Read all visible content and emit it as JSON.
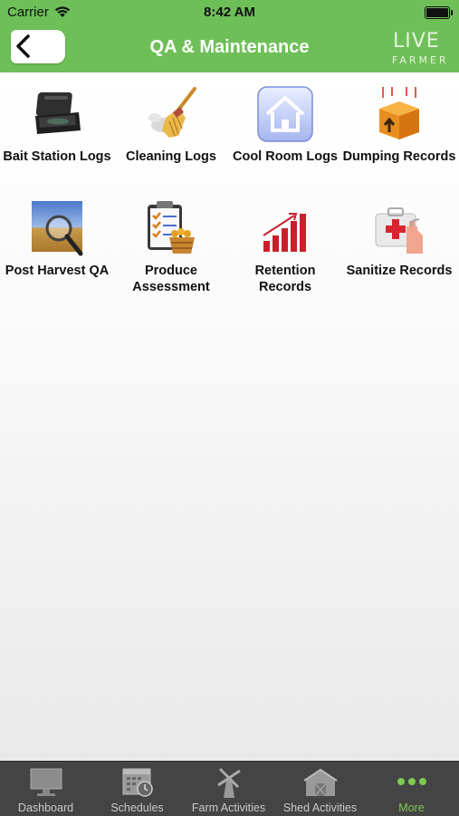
{
  "status_bar": {
    "carrier": "Carrier",
    "time": "8:42 AM"
  },
  "nav": {
    "title": "QA & Maintenance",
    "logo_line1": "LIVE",
    "logo_line2": "FARMER"
  },
  "grid": [
    {
      "label": "Bait Station Logs",
      "icon": "bait-station-icon"
    },
    {
      "label": "Cleaning Logs",
      "icon": "broom-icon"
    },
    {
      "label": "Cool Room Logs",
      "icon": "house-icon"
    },
    {
      "label": "Dumping Records",
      "icon": "box-upload-icon"
    },
    {
      "label": "Post Harvest QA",
      "icon": "magnifier-wheat-icon"
    },
    {
      "label": "Produce Assessment",
      "icon": "checklist-basket-icon"
    },
    {
      "label": "Retention Records",
      "icon": "bar-chart-icon"
    },
    {
      "label": "Sanitize Records",
      "icon": "sanitizer-kit-icon"
    }
  ],
  "tabs": [
    {
      "label": "Dashboard",
      "icon": "monitor-icon"
    },
    {
      "label": "Schedules",
      "icon": "calendar-clock-icon"
    },
    {
      "label": "Farm Activities",
      "icon": "windmill-icon"
    },
    {
      "label": "Shed Activities",
      "icon": "shed-icon"
    },
    {
      "label": "More",
      "icon": "more-dots-icon"
    }
  ],
  "colors": {
    "accent_green": "#6ebf58",
    "tab_bar": "#444444",
    "active_tab": "#7ec94f"
  }
}
